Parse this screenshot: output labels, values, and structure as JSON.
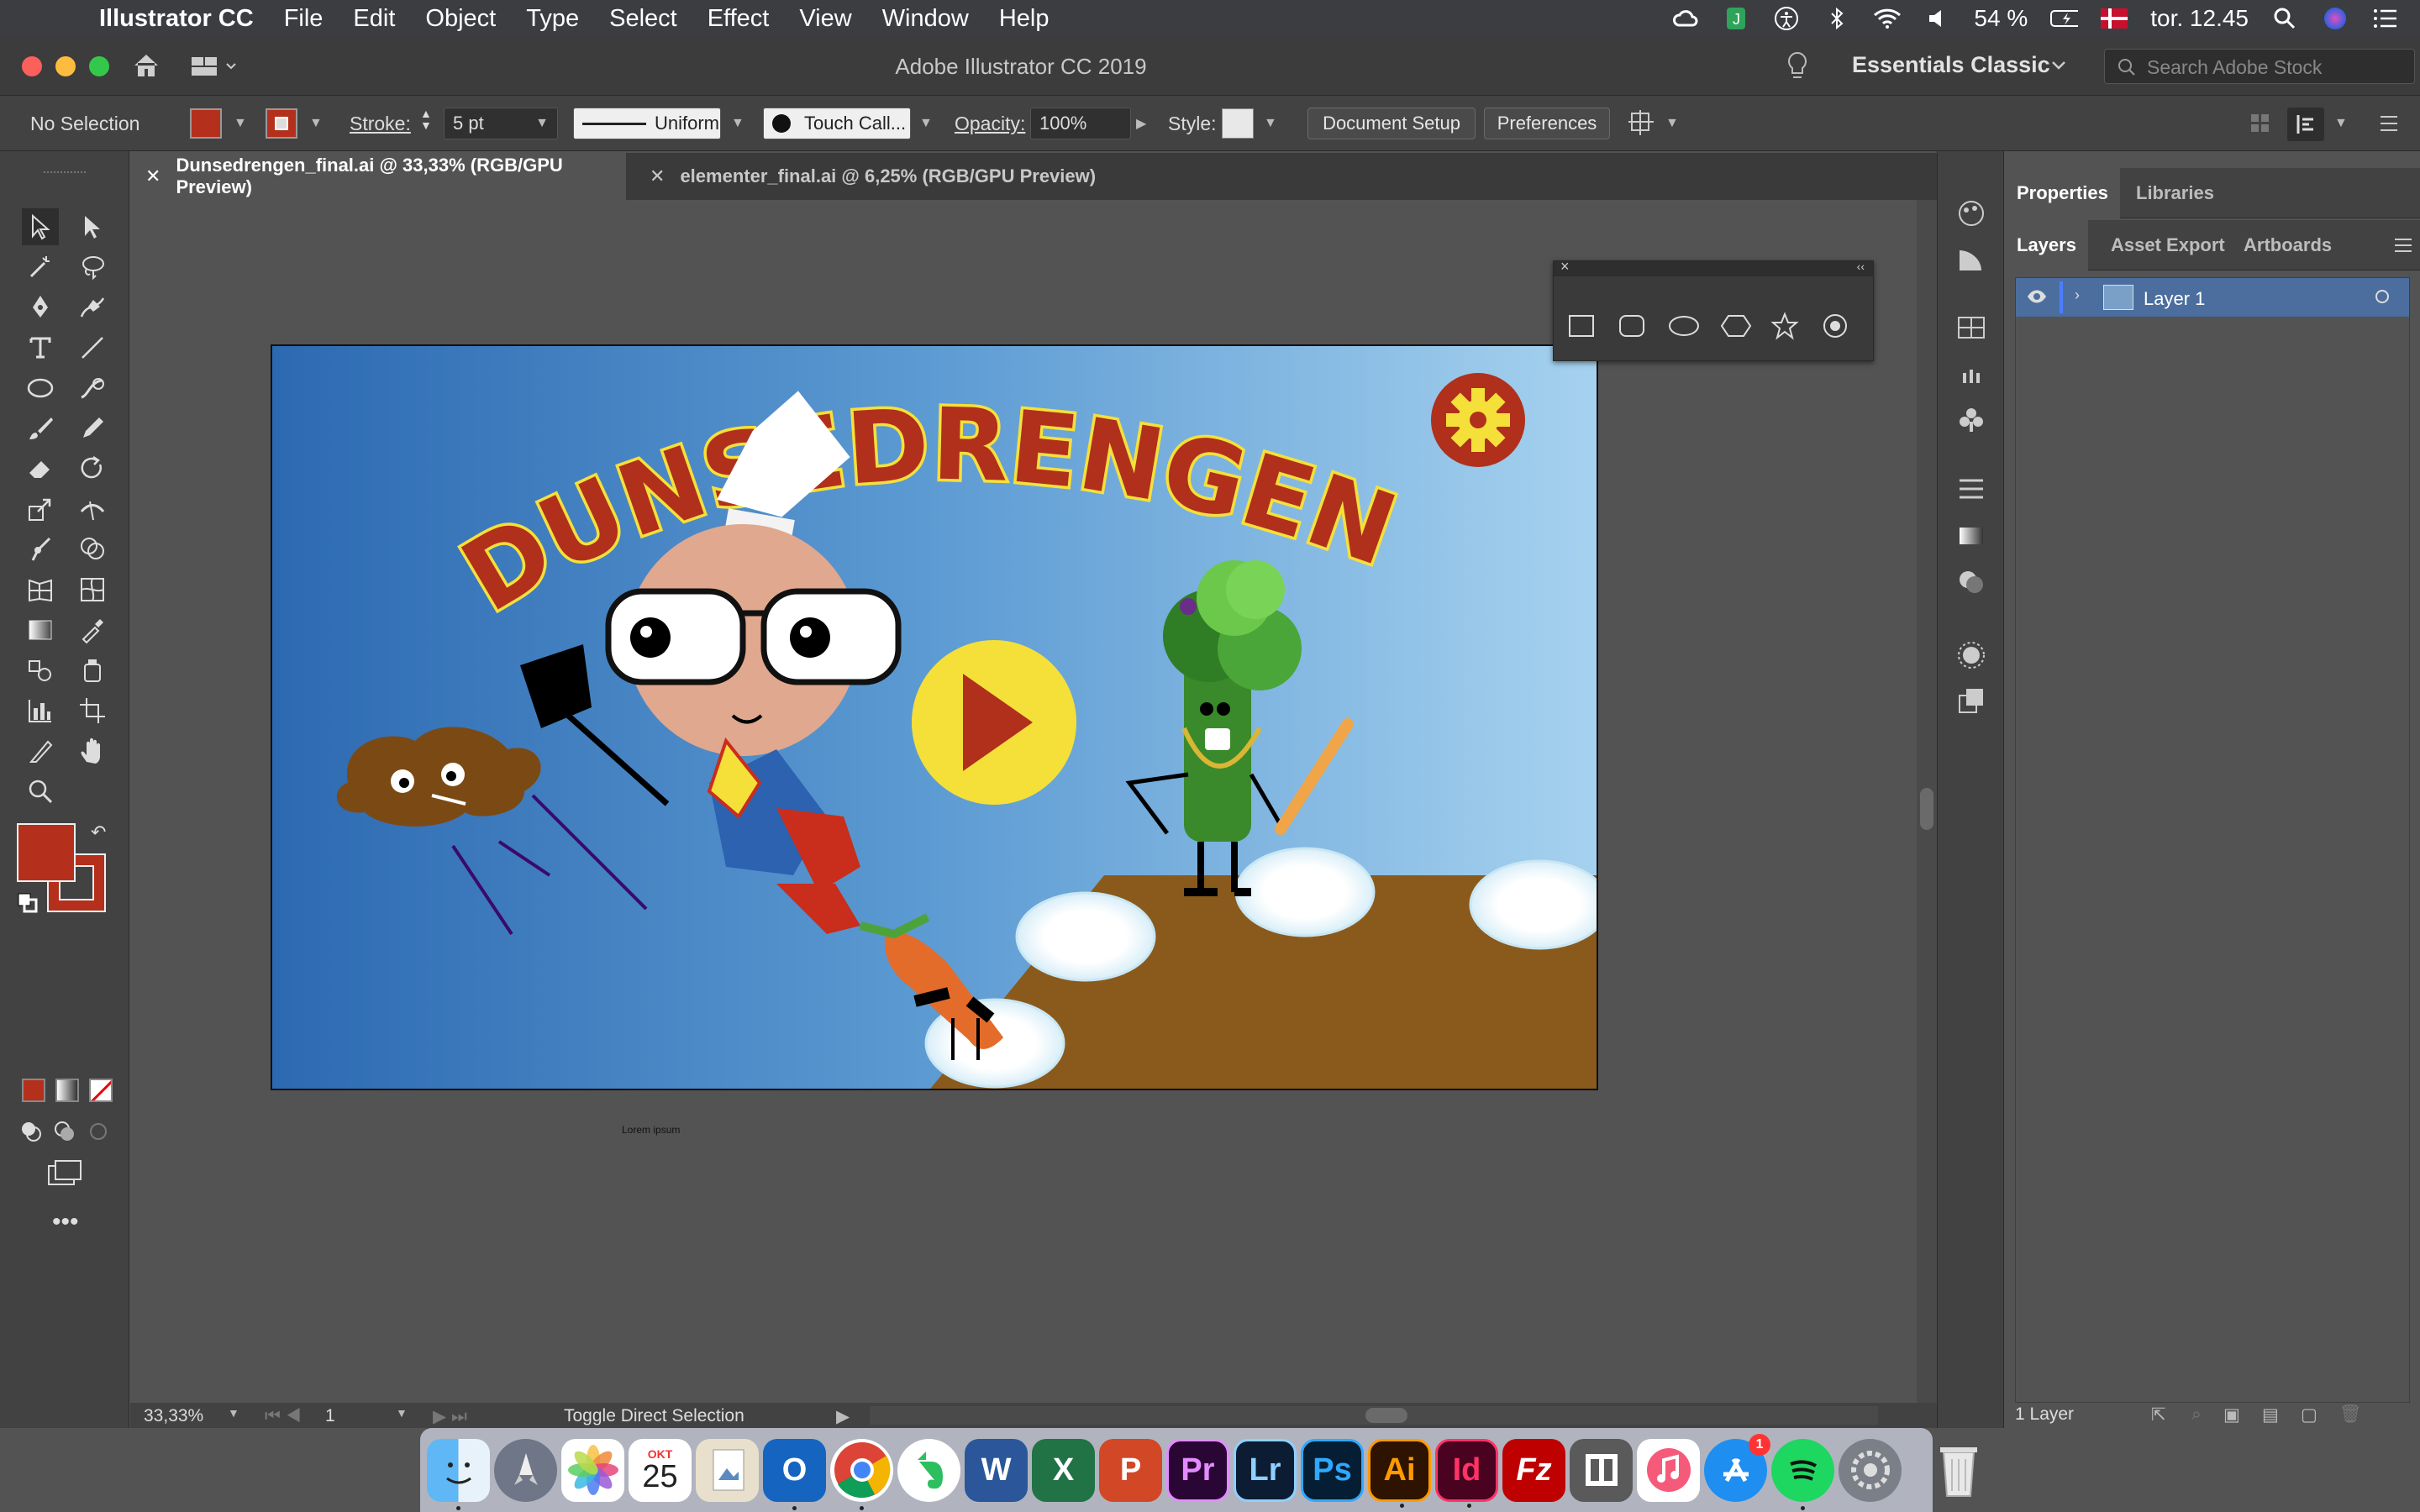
{
  "menubar": {
    "app_name": "Illustrator CC",
    "items": [
      "File",
      "Edit",
      "Object",
      "Type",
      "Select",
      "Effect",
      "View",
      "Window",
      "Help"
    ],
    "battery": "54 %",
    "clock": "tor. 12.45"
  },
  "titlebar": {
    "title": "Adobe Illustrator CC 2019",
    "workspace": "Essentials Classic",
    "search_placeholder": "Search Adobe Stock"
  },
  "controlbar": {
    "selection": "No Selection",
    "stroke_label": "Stroke:",
    "stroke_value": "5 pt",
    "profile": "Uniform",
    "brush": "Touch Call...",
    "opacity_label": "Opacity:",
    "opacity_value": "100%",
    "style_label": "Style:",
    "document_setup": "Document Setup",
    "preferences": "Preferences",
    "fill_color": "#b5301c",
    "stroke_color": "#b5301c"
  },
  "tabs": [
    {
      "label": "Dunsedrengen_final.ai @ 33,33% (RGB/GPU Preview)",
      "active": true
    },
    {
      "label": "elementer_final.ai @ 6,25% (RGB/GPU Preview)",
      "active": false
    }
  ],
  "artwork": {
    "title": "DUNSEDRENGEN",
    "below_text": "Lorem ipsum",
    "colors": {
      "sky_left": "#2d6db3",
      "sky_right": "#a8d3ef",
      "table": "#8a5a1c",
      "title_fill": "#b0301c",
      "title_outline": "#f5e03a"
    }
  },
  "statusbar": {
    "zoom": "33,33%",
    "artboard_number": "1",
    "status_text": "Toggle Direct Selection"
  },
  "right_panel": {
    "top_tabs": [
      "Properties",
      "Libraries"
    ],
    "layer_tabs": [
      "Layers",
      "Asset Export",
      "Artboards"
    ],
    "layers": [
      {
        "name": "Layer 1"
      }
    ],
    "footer_count": "1 Layer"
  },
  "dock": {
    "calendar_month": "OKT",
    "calendar_day": "25",
    "appstore_badge": "1",
    "labels": {
      "premiere": "Pr",
      "lightroom": "Lr",
      "photoshop": "Ps",
      "illustrator": "Ai",
      "indesign": "Id"
    }
  }
}
